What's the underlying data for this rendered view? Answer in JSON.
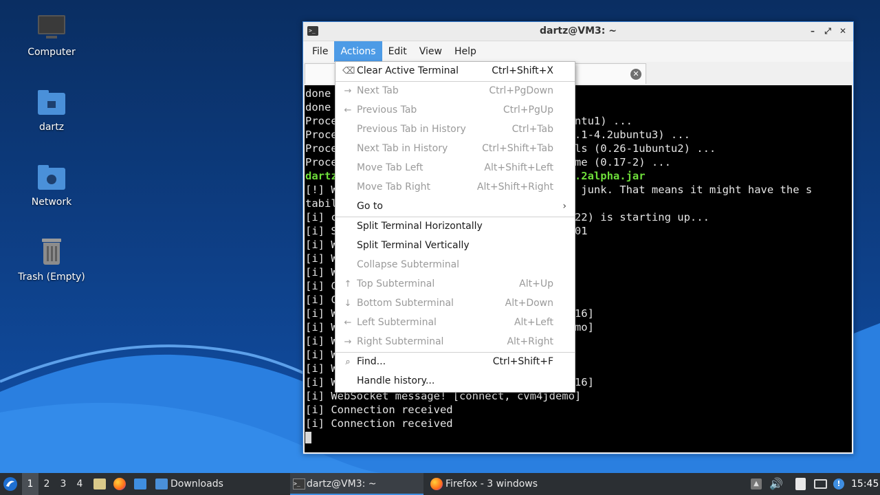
{
  "desktop": {
    "icons": [
      {
        "label": "Computer",
        "icon": "computer-icon"
      },
      {
        "label": "dartz",
        "icon": "home-folder-icon"
      },
      {
        "label": "Network",
        "icon": "network-folder-icon"
      },
      {
        "label": "Trash (Empty)",
        "icon": "trash-icon"
      }
    ]
  },
  "window": {
    "title": "dartz@VM3: ~",
    "controls": {
      "minimize": "–",
      "maximize": "⤢",
      "close": "✕"
    }
  },
  "menubar": [
    "File",
    "Actions",
    "Edit",
    "View",
    "Help"
  ],
  "terminal": {
    "lines": [
      "done",
      "done",
      "Proce                                    untu1) ...",
      "Proce                                    3.1-4.2ubuntu3) ...",
      "Proce                                    ils (0.26-1ubuntu2) ...",
      "Proce                                    eme (0.17-2) ...",
      "dartz                                    0.2alpha.jar",
      "[!] W                                    s junk. That means it might have the s",
      "tabil",
      "[i] c                                    022) is starting up...",
      "[i] S                                    401",
      "[i] W",
      "[i] W",
      "[i] W",
      "[i] C",
      "[i] C",
      "[i] W                                    016]",
      "[i] W                                    emo]",
      "[i] W",
      "[i] W",
      "[i] W",
      "[i] W                                    016]",
      "[i] WebSocket message! [connect, cvm4jdemo]",
      "[i] Connection received",
      "[i] Connection received"
    ]
  },
  "actions_menu": {
    "items": [
      {
        "label": "Clear Active Terminal",
        "shortcut": "Ctrl+Shift+X",
        "icon": "clear-icon",
        "glyph": "⌫",
        "disabled": false
      },
      {
        "sep": true
      },
      {
        "label": "Next Tab",
        "shortcut": "Ctrl+PgDown",
        "icon": "arrow-right-icon",
        "glyph": "→",
        "disabled": true
      },
      {
        "label": "Previous Tab",
        "shortcut": "Ctrl+PgUp",
        "icon": "arrow-left-icon",
        "glyph": "←",
        "disabled": true
      },
      {
        "label": "Previous Tab in History",
        "shortcut": "Ctrl+Tab",
        "icon": "",
        "glyph": "",
        "disabled": true
      },
      {
        "label": "Next Tab in History",
        "shortcut": "Ctrl+Shift+Tab",
        "icon": "",
        "glyph": "",
        "disabled": true
      },
      {
        "label": "Move Tab Left",
        "shortcut": "Alt+Shift+Left",
        "icon": "",
        "glyph": "",
        "disabled": true
      },
      {
        "label": "Move Tab Right",
        "shortcut": "Alt+Shift+Right",
        "icon": "",
        "glyph": "",
        "disabled": true
      },
      {
        "label": "Go to",
        "shortcut": "",
        "icon": "",
        "glyph": "",
        "disabled": false,
        "submenu": true
      },
      {
        "sep": true
      },
      {
        "label": "Split Terminal Horizontally",
        "shortcut": "",
        "icon": "",
        "glyph": "",
        "disabled": false
      },
      {
        "label": "Split Terminal Vertically",
        "shortcut": "",
        "icon": "",
        "glyph": "",
        "disabled": false
      },
      {
        "label": "Collapse Subterminal",
        "shortcut": "",
        "icon": "",
        "glyph": "",
        "disabled": true
      },
      {
        "label": "Top Subterminal",
        "shortcut": "Alt+Up",
        "icon": "arrow-up-icon",
        "glyph": "↑",
        "disabled": true
      },
      {
        "label": "Bottom Subterminal",
        "shortcut": "Alt+Down",
        "icon": "arrow-down-icon",
        "glyph": "↓",
        "disabled": true
      },
      {
        "label": "Left Subterminal",
        "shortcut": "Alt+Left",
        "icon": "arrow-left-icon",
        "glyph": "←",
        "disabled": true
      },
      {
        "label": "Right Subterminal",
        "shortcut": "Alt+Right",
        "icon": "arrow-right-icon",
        "glyph": "→",
        "disabled": true
      },
      {
        "sep": true
      },
      {
        "label": "Find...",
        "shortcut": "Ctrl+Shift+F",
        "icon": "search-icon",
        "glyph": "⌕",
        "disabled": false
      },
      {
        "label": "Handle history...",
        "shortcut": "",
        "icon": "",
        "glyph": "",
        "disabled": false
      }
    ]
  },
  "taskbar": {
    "workspaces": [
      "1",
      "2",
      "3",
      "4"
    ],
    "active_workspace": "1",
    "tasks": [
      {
        "label": "Downloads",
        "icon": "folder-icon"
      },
      {
        "label": "dartz@VM3: ~",
        "icon": "terminal-icon",
        "active": true
      },
      {
        "label": "Firefox - 3 windows",
        "icon": "firefox-icon"
      }
    ],
    "clock": "15:45"
  },
  "colors": {
    "accent": "#4d9be6",
    "taskbar": "#2b2f33",
    "terminal_bg": "#000000",
    "prompt_green": "#6ede3a"
  }
}
